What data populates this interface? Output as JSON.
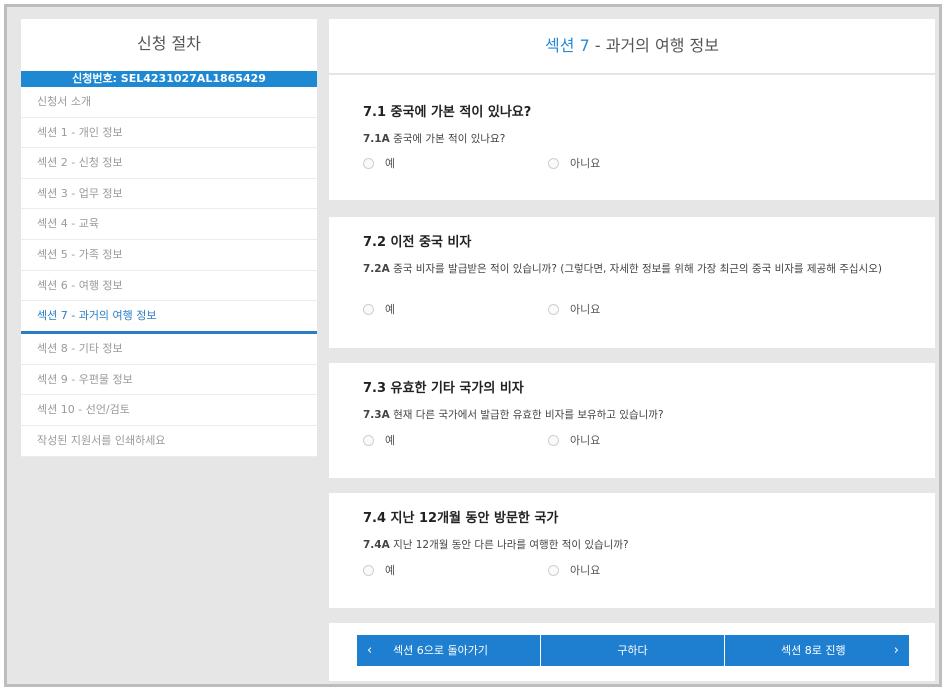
{
  "sidebar": {
    "title": "신청 절차",
    "application_number": "신청번호: SEL4231027AL1865429",
    "items": [
      {
        "label": "신청서 소개"
      },
      {
        "label": "섹션 1 - 개인 정보"
      },
      {
        "label": "섹션 2 - 신청 정보"
      },
      {
        "label": "섹션 3 - 업무 정보"
      },
      {
        "label": "섹션 4 - 교육"
      },
      {
        "label": "섹션 5 - 가족 정보"
      },
      {
        "label": "섹션 6 - 여행 정보"
      },
      {
        "label": "섹션 7 - 과거의 여행 정보"
      },
      {
        "label": "섹션 8 - 기타 정보"
      },
      {
        "label": "섹션 9 - 우편물 정보"
      },
      {
        "label": "섹션 10 - 선언/검토"
      },
      {
        "label": "작성된 지원서를 인쇄하세요"
      }
    ],
    "active_index": 7
  },
  "header": {
    "section_word": "섹션",
    "section_number": "7",
    "separator": "-",
    "title": "과거의 여행 정보"
  },
  "questions": [
    {
      "heading": "7.1 중국에 가본 적이 있나요?",
      "code": "7.1A",
      "text": "중국에 가본 적이 있나요?",
      "yes": "예",
      "no": "아니요"
    },
    {
      "heading": "7.2 이전 중국 비자",
      "code": "7.2A",
      "text": "중국 비자를 발급받은 적이 있습니까? (그렇다면, 자세한 정보를 위해 가장 최근의 중국 비자를 제공해 주십시오)",
      "yes": "예",
      "no": "아니요"
    },
    {
      "heading": "7.3 유효한 기타 국가의 비자",
      "code": "7.3A",
      "text": "현재 다른 국가에서 발급한 유효한 비자를 보유하고 있습니까?",
      "yes": "예",
      "no": "아니요"
    },
    {
      "heading": "7.4 지난 12개월 동안 방문한 국가",
      "code": "7.4A",
      "text": "지난 12개월 동안 다른 나라를 여행한 적이 있습니까?",
      "yes": "예",
      "no": "아니요"
    }
  ],
  "footer": {
    "back_label": "섹션 6으로 돌아가기",
    "save_label": "구하다",
    "next_label": "섹션 8로 진행",
    "back_icon": "chevron-left-icon",
    "next_icon": "chevron-right-icon"
  },
  "colors": {
    "accent": "#1e7fd1",
    "active_nav": "#2a7ec6"
  }
}
